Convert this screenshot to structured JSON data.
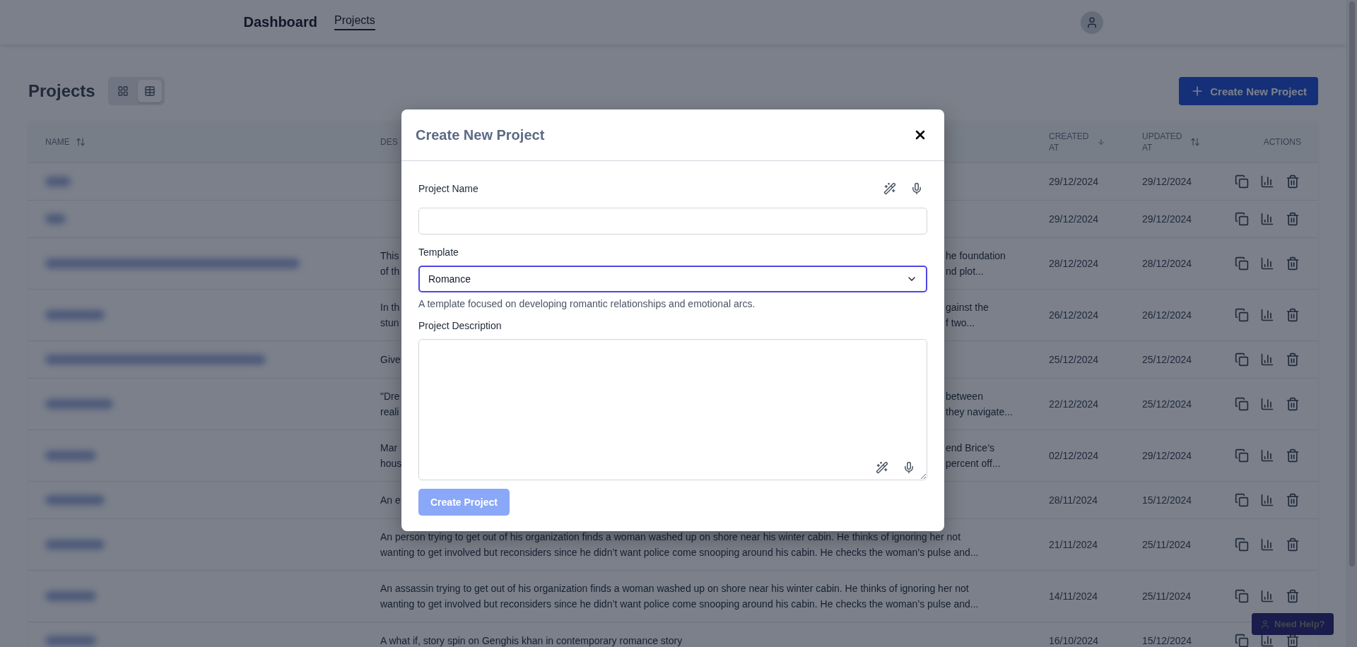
{
  "header": {
    "brand": "Dashboard",
    "nav": [
      {
        "label": "Projects",
        "selected": true
      }
    ]
  },
  "page": {
    "title": "Projects",
    "view_toggle": [
      {
        "kind": "grid",
        "selected": false
      },
      {
        "kind": "table",
        "selected": true
      }
    ],
    "create_button": "Create New Project"
  },
  "table": {
    "columns": [
      {
        "label": "NAME",
        "sortable": true,
        "sorted": false
      },
      {
        "label": "DES"
      },
      {
        "label": "CREATED AT",
        "sortable": true,
        "sorted": true
      },
      {
        "label": "UPDATED AT",
        "sortable": true,
        "sorted": false
      },
      {
        "label": "ACTIONS"
      }
    ],
    "rows": [
      {
        "created": "29/12/2024",
        "updated": "29/12/2024"
      },
      {
        "created": "29/12/2024",
        "updated": "29/12/2024"
      },
      {
        "description_start": [
          "This",
          "of th"
        ],
        "description_end": [
          "he foundation",
          "nd plot..."
        ],
        "created": "28/12/2024",
        "updated": "28/12/2024"
      },
      {
        "description_start": [
          "In th",
          "stun"
        ],
        "description_end": [
          "gainst the",
          "f two..."
        ],
        "created": "26/12/2024",
        "updated": "26/12/2024"
      },
      {
        "description_start": [
          "Give"
        ],
        "created": "25/12/2024",
        "updated": "25/12/2024"
      },
      {
        "description_start": [
          "\"Dre",
          "reali"
        ],
        "description_end": [
          "between",
          "they navigate..."
        ],
        "created": "22/12/2024",
        "updated": "25/12/2024"
      },
      {
        "description_start": [
          "Mar",
          "hous"
        ],
        "description_end": [
          "end Brice’s",
          "percent off..."
        ],
        "created": "02/12/2024",
        "updated": "29/12/2024"
      },
      {
        "description_start": [
          "An e"
        ],
        "created": "28/11/2024",
        "updated": "15/12/2024"
      },
      {
        "description": [
          "An person trying to get out of his organization finds a woman washed up on shore near his winter cabin. He thinks of ignoring her not",
          "wanting to get involved but reconsiders since he didn’t want police come snooping around his cabin. He checks the woman’s pulse and..."
        ],
        "created": "21/11/2024",
        "updated": "25/11/2024"
      },
      {
        "description": [
          "An assassin trying to get out of his organization finds a woman washed up on shore near his winter cabin. He thinks of ignoring her not",
          "wanting to get involved but reconsiders since he didn’t want police come snooping around his cabin. He checks the woman’s pulse and..."
        ],
        "created": "14/11/2024",
        "updated": "25/11/2024"
      },
      {
        "description": [
          "A what if, story spin on Genghis khan in contemporary romance story"
        ],
        "created": "16/10/2024",
        "updated": "15/12/2024"
      }
    ]
  },
  "help_button": "Need Help?",
  "modal": {
    "title": "Create New Project",
    "fields": [
      {
        "kind": "text",
        "label": "Project Name"
      },
      {
        "kind": "select",
        "label": "Template",
        "value": "Romance",
        "focused": true,
        "hint": "A template focused on developing romantic relationships and emotional arcs."
      },
      {
        "kind": "textarea",
        "label": "Project Description"
      }
    ],
    "submit": {
      "label": "Create Project",
      "disabled": true
    }
  }
}
